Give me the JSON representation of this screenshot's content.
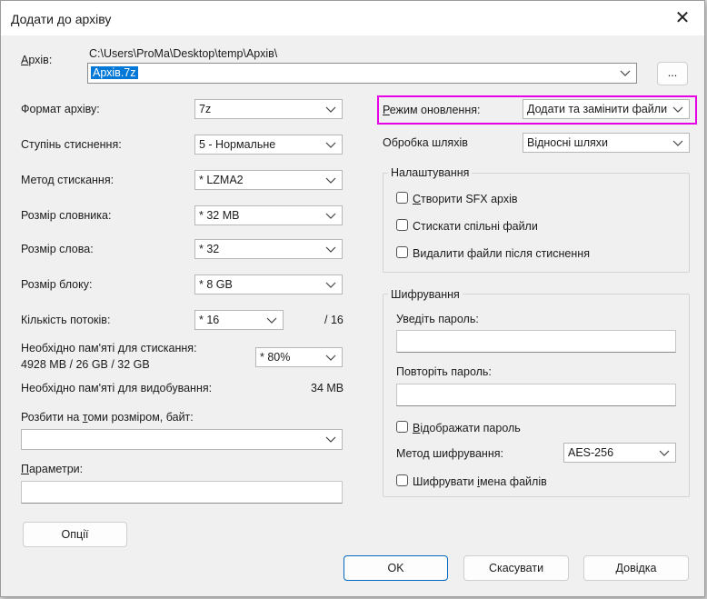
{
  "window": {
    "title": "Додати до архіву",
    "close_glyph": "✕"
  },
  "archive": {
    "label": "Архів:",
    "path": "C:\\Users\\ProMa\\Desktop\\temp\\Архів\\",
    "name": "Архів.7z",
    "browse_label": "..."
  },
  "left": {
    "format": {
      "label": "Формат архіву:",
      "value": "7z"
    },
    "level": {
      "label": "Ступінь стиснення:",
      "value": "5 - Нормальне"
    },
    "method": {
      "label": "Метод стискання:",
      "value": "*  LZMA2"
    },
    "dict": {
      "label": "Розмір словника:",
      "value": "*  32 MB"
    },
    "word": {
      "label": "Розмір слова:",
      "value": "*  32"
    },
    "block": {
      "label": "Розмір блоку:",
      "value": "*  8 GB"
    },
    "threads": {
      "label": "Кількість потоків:",
      "value": "*  16",
      "max": "/ 16"
    },
    "mem_compress": {
      "label": "Необхідно пам'яті для стискання:",
      "detail": "4928 MB / 26 GB / 32 GB",
      "value": "*  80%"
    },
    "mem_decompress": {
      "label": "Необхідно пам'яті для видобування:",
      "value": "34 MB"
    },
    "split": {
      "label": "Розбити на томи розміром, байт:",
      "value": ""
    },
    "params": {
      "label": "Параметри:",
      "value": ""
    },
    "options_button": "Опції"
  },
  "right": {
    "update_mode": {
      "label": "Режим оновлення:",
      "value": "Додати та замінити файли"
    },
    "path_mode": {
      "label": "Обробка шляхів",
      "value": "Відносні шляхи"
    },
    "settings": {
      "title": "Налаштування",
      "sfx": "Створити SFX архів",
      "shared": "Стискати спільні файли",
      "delete": "Видалити файли після стиснення"
    },
    "encryption": {
      "title": "Шифрування",
      "enter_password": "Уведіть пароль:",
      "repeat_password": "Повторіть пароль:",
      "show_password": "Відображати пароль",
      "method_label": "Метод шифрування:",
      "method_value": "AES-256",
      "encrypt_names": "Шифрувати імена файлів"
    }
  },
  "buttons": {
    "ok": "OK",
    "cancel": "Скасувати",
    "help": "Довідка"
  },
  "colors": {
    "highlight": "#e600e6",
    "selection": "#0078d7",
    "primary_border": "#0067c0"
  }
}
